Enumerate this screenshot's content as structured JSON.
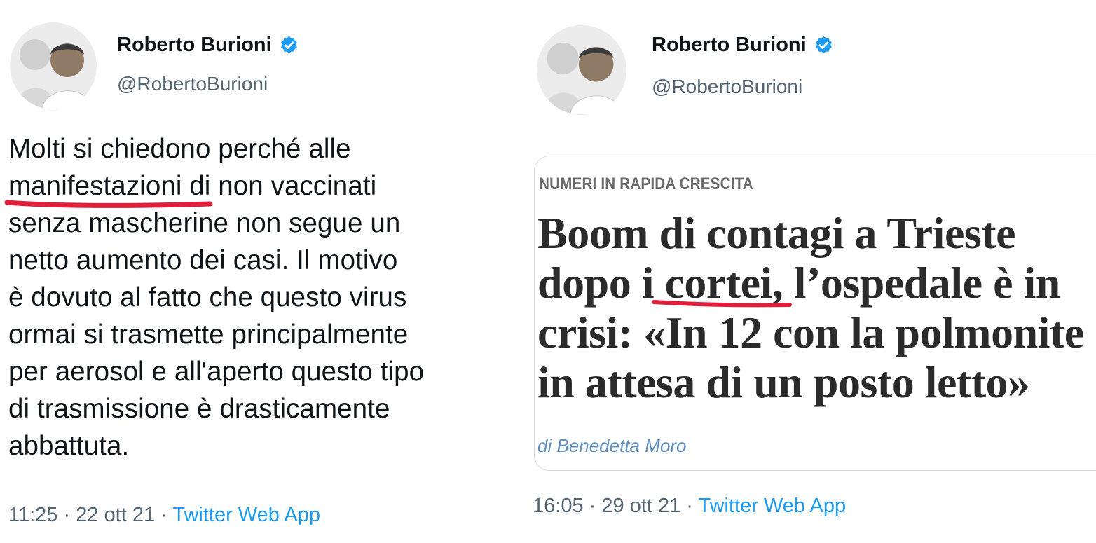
{
  "left_tweet": {
    "author_name": "Roberto Burioni",
    "author_handle": "@RobertoBurioni",
    "text_lines": [
      "Molti si chiedono perché alle",
      "manifestazioni",
      " di non vaccinati",
      "senza mascherine non segue un",
      "netto aumento dei casi. Il motivo",
      "è dovuto al fatto che questo virus",
      "ormai si trasmette principalmente",
      "per aerosol e all'aperto questo tipo",
      "di trasmissione è drasticamente",
      "abbattuta."
    ],
    "time": "11:25",
    "date": "22 ott 21",
    "separator": " · ",
    "source": "Twitter Web App"
  },
  "right_tweet": {
    "author_name": "Roberto Burioni",
    "author_handle": "@RobertoBurioni",
    "card": {
      "kicker": "NUMERI IN RAPIDA CRESCITA",
      "headline_lines": [
        "Boom di contagi a Trieste",
        "dopo ",
        "i cortei,",
        " l’ospedale è in",
        "crisi: «In 12 con la polmonite",
        "in attesa di un posto letto»"
      ],
      "byline": "di Benedetta Moro"
    },
    "time": "16:05",
    "date": "29 ott 21",
    "separator": " · ",
    "source": "Twitter Web App"
  },
  "colors": {
    "text": "#0f1419",
    "secondary": "#536471",
    "link": "#1d9bf0",
    "verified": "#1d9bf0",
    "highlight_underline": "#e0203a",
    "card_border": "#cfd9de"
  },
  "icons": [
    "verified-badge-icon",
    "avatar-image"
  ]
}
